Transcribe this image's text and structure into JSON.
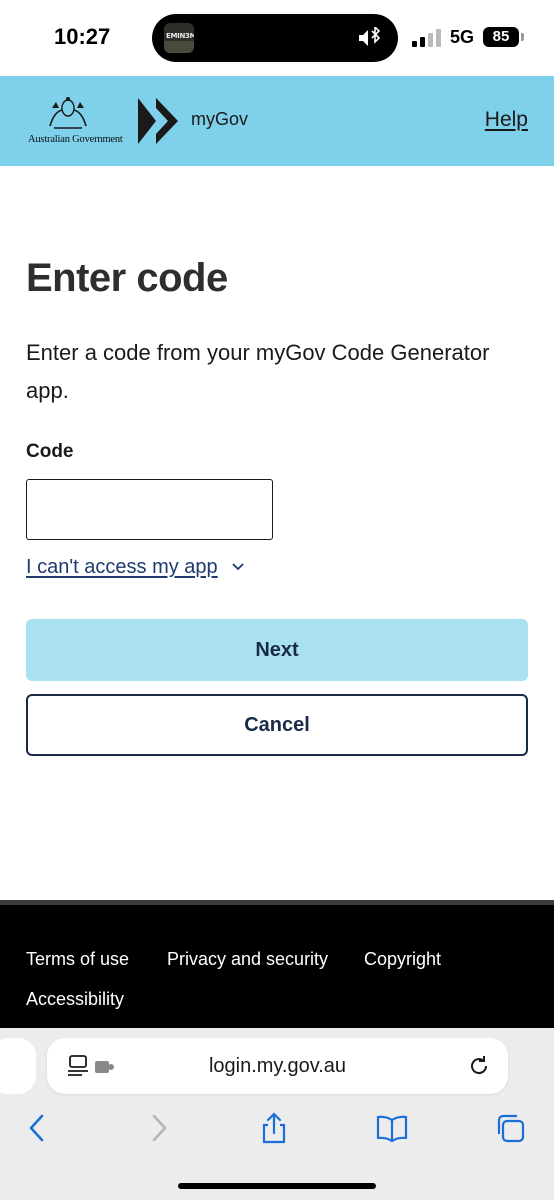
{
  "status_bar": {
    "time": "10:27",
    "now_playing_art_text": "EMIN3M",
    "network": "5G",
    "battery": "85"
  },
  "header": {
    "government_name": "Australian Government",
    "brand": "myGov",
    "help_label": "Help",
    "background_color": "#7fd0ea"
  },
  "main": {
    "title": "Enter code",
    "intro": "Enter a code from your myGov Code Generator app.",
    "code_label": "Code",
    "code_value": "",
    "cant_access_label": "I can't access my app",
    "next_label": "Next",
    "cancel_label": "Cancel"
  },
  "footer": {
    "links": [
      "Terms of use",
      "Privacy and security",
      "Copyright",
      "Accessibility"
    ]
  },
  "browser": {
    "url": "login.my.gov.au"
  },
  "icons": [
    "crest-icon",
    "mygov-logo-icon",
    "chevron-down-icon",
    "reader-icon",
    "extension-icon",
    "reload-icon",
    "back-icon",
    "forward-icon",
    "share-icon",
    "bookmarks-icon",
    "tabs-icon",
    "mute-icon",
    "bluetooth-icon"
  ]
}
